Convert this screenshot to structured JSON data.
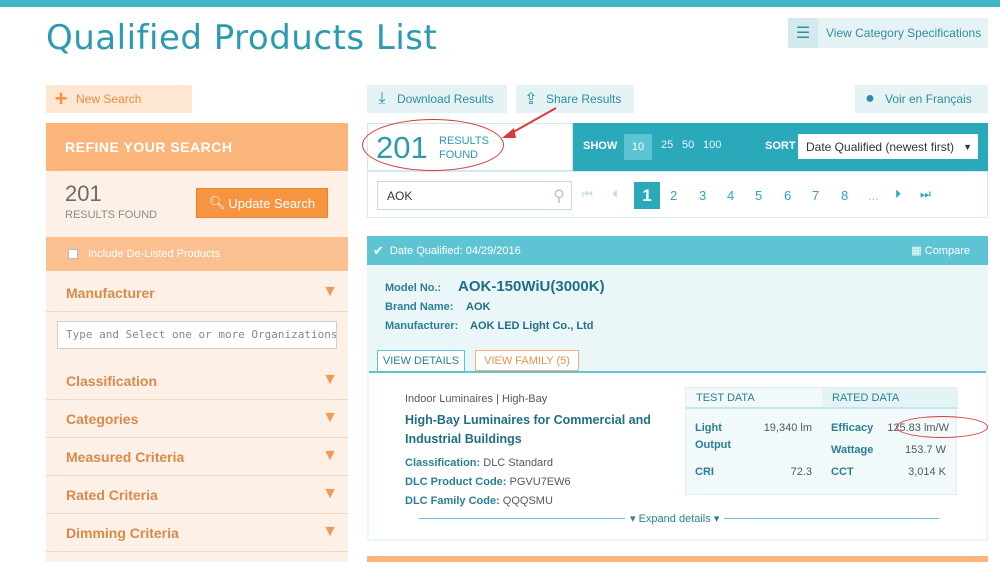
{
  "header": {
    "title": "Qualified Products List",
    "view_category_label": "View Category Specifications"
  },
  "left": {
    "new_search": "New Search",
    "refine_title": "REFINE YOUR SEARCH",
    "results_count": "201",
    "results_label": "RESULTS FOUND",
    "update_button": "Update Search",
    "include_delisted": "Include De-Listed Products",
    "manufacturer": "Manufacturer",
    "org_placeholder": "Type and Select one or more Organizations",
    "classification": "Classification",
    "categories": "Categories",
    "measured": "Measured Criteria",
    "rated": "Rated Criteria",
    "dimming": "Dimming Criteria"
  },
  "toolbar": {
    "download": "Download Results",
    "share": "Share Results",
    "french": "Voir en Français"
  },
  "results_bar": {
    "count": "201",
    "label_line1": "RESULTS",
    "label_line2": "FOUND",
    "show_label": "SHOW",
    "show_options": [
      "10",
      "25",
      "50",
      "100"
    ],
    "sort_label": "SORT",
    "sort_value": "Date Qualified (newest first)"
  },
  "search": {
    "value": "AOK"
  },
  "pagination": {
    "current": "1",
    "pages": [
      "2",
      "3",
      "4",
      "5",
      "6",
      "7",
      "8",
      "..."
    ]
  },
  "product": {
    "date_qualified": "Date Qualified: 04/29/2016",
    "compare": "Compare",
    "model_label": "Model No.:",
    "model": "AOK-150WiU(3000K)",
    "brand_label": "Brand Name:",
    "brand": "AOK",
    "manufacturer_label": "Manufacturer:",
    "manufacturer": "AOK LED Light Co., Ltd",
    "tab_details": "VIEW DETAILS",
    "tab_family": "VIEW FAMILY (5)",
    "category_path": "Indoor Luminaires | High-Bay",
    "category_title": "High-Bay Luminaires for Commercial and Industrial Buildings",
    "classification_label": "Classification:",
    "classification": "DLC Standard",
    "product_code_label": "DLC Product Code:",
    "product_code": "PGVU7EW6",
    "family_code_label": "DLC Family Code:",
    "family_code": "QQQSMU",
    "test_data_title": "TEST DATA",
    "rated_data_title": "RATED DATA",
    "light_output_label_1": "Light",
    "light_output_label_2": "Output",
    "light_output": "19,340 lm",
    "cri_label": "CRI",
    "cri": "72.3",
    "efficacy_label": "Efficacy",
    "efficacy": "125.83 lm/W",
    "wattage_label": "Wattage",
    "wattage": "153.7 W",
    "cct_label": "CCT",
    "cct": "3,014 K",
    "expand": "Expand details"
  }
}
